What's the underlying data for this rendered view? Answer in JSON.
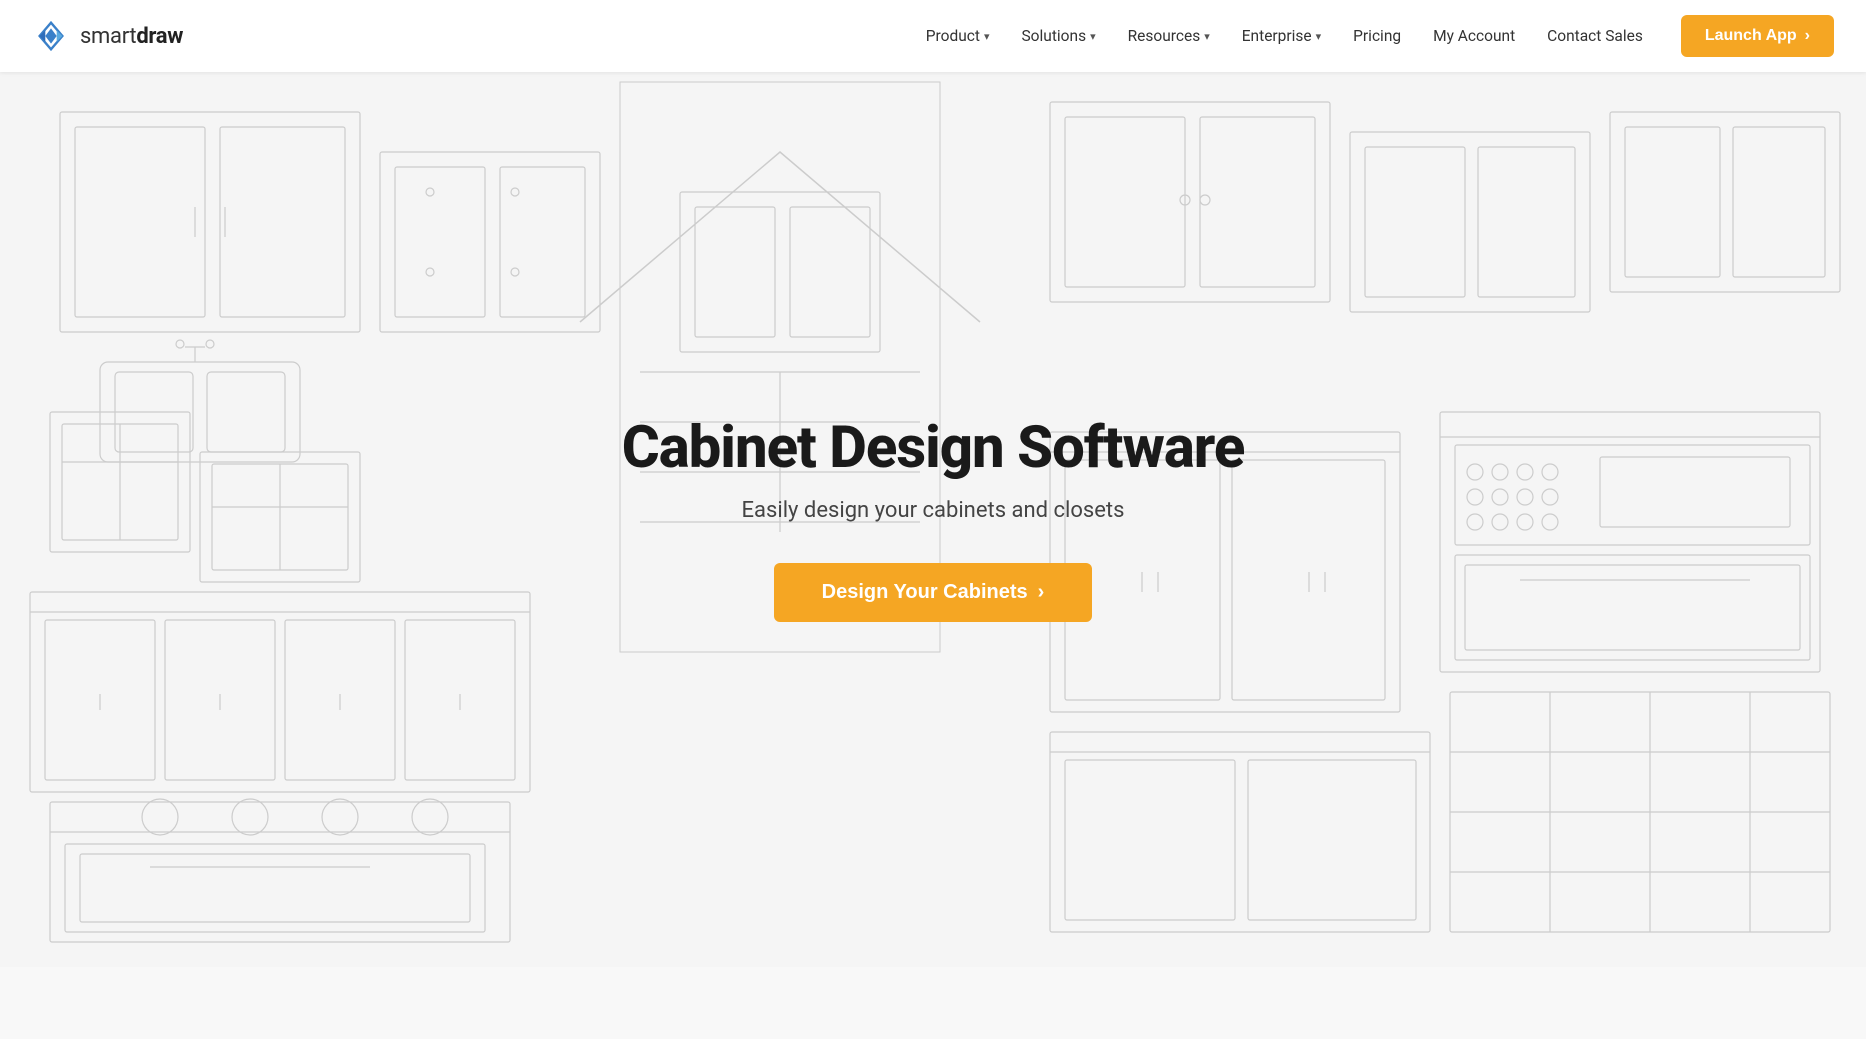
{
  "brand": {
    "logo_alt": "SmartDraw logo",
    "name_prefix": "smart",
    "name_suffix": "draw",
    "trademark": "™"
  },
  "nav": {
    "items": [
      {
        "label": "Product",
        "has_dropdown": true
      },
      {
        "label": "Solutions",
        "has_dropdown": true
      },
      {
        "label": "Resources",
        "has_dropdown": true
      },
      {
        "label": "Enterprise",
        "has_dropdown": true
      },
      {
        "label": "Pricing",
        "has_dropdown": false
      },
      {
        "label": "My Account",
        "has_dropdown": false
      },
      {
        "label": "Contact Sales",
        "has_dropdown": false
      }
    ],
    "cta_label": "Launch App",
    "cta_arrow": "›"
  },
  "hero": {
    "title": "Cabinet Design Software",
    "subtitle": "Easily design your cabinets and closets",
    "cta_label": "Design Your Cabinets",
    "cta_arrow": "›"
  },
  "colors": {
    "accent": "#f5a623",
    "accent_dark": "#e09600",
    "text_primary": "#1a1a1a",
    "text_secondary": "#444444",
    "nav_text": "#333333",
    "drawing_stroke": "#d0d0d0"
  }
}
